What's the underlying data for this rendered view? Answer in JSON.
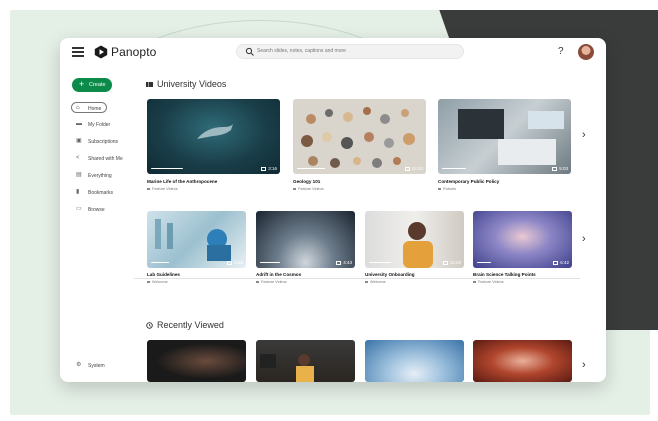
{
  "app": {
    "brand": "Panopto",
    "search_placeholder": "Search slides, notes, captions and more",
    "help": "?"
  },
  "sidebar": {
    "create_label": "Create",
    "items": [
      {
        "label": "Home",
        "icon": "home-icon"
      },
      {
        "label": "My Folder",
        "icon": "folder-icon"
      },
      {
        "label": "Subscriptions",
        "icon": "lock-icon"
      },
      {
        "label": "Shared with Me",
        "icon": "share-icon"
      },
      {
        "label": "Everything",
        "icon": "list-icon"
      },
      {
        "label": "Bookmarks",
        "icon": "bookmark-icon"
      },
      {
        "label": "Browse",
        "icon": "browse-icon"
      }
    ],
    "system_label": "System"
  },
  "sections": {
    "university": {
      "title": "University Videos",
      "row1": [
        {
          "title": "Marine Life of the Anthropocene",
          "folder": "Feature Videos",
          "duration": "3:16",
          "progress": 0.4
        },
        {
          "title": "Geology 101",
          "folder": "Feature Videos",
          "duration": "22:42",
          "progress": 0.35
        },
        {
          "title": "Contemporary Public Policy",
          "folder": "Policies",
          "duration": "5:03",
          "progress": 0.3
        }
      ],
      "row2": [
        {
          "title": "Lab Guidelines",
          "folder": "Welcome",
          "duration": "2:25",
          "progress": 0.25
        },
        {
          "title": "Adrift in the Cosmos",
          "folder": "Feature Videos",
          "duration": "4:43",
          "progress": 0.3
        },
        {
          "title": "University Onboarding",
          "folder": "Welcome",
          "duration": "12:20",
          "progress": 0.35
        },
        {
          "title": "Brain Science Talking Points",
          "folder": "Feature Videos",
          "duration": "6:42",
          "progress": 0.2
        }
      ]
    },
    "recent": {
      "title": "Recently Viewed"
    }
  },
  "colors": {
    "brand_green": "#0c8a4a",
    "background_green": "#e4efe6",
    "dark_shape": "#3a3c3b"
  }
}
